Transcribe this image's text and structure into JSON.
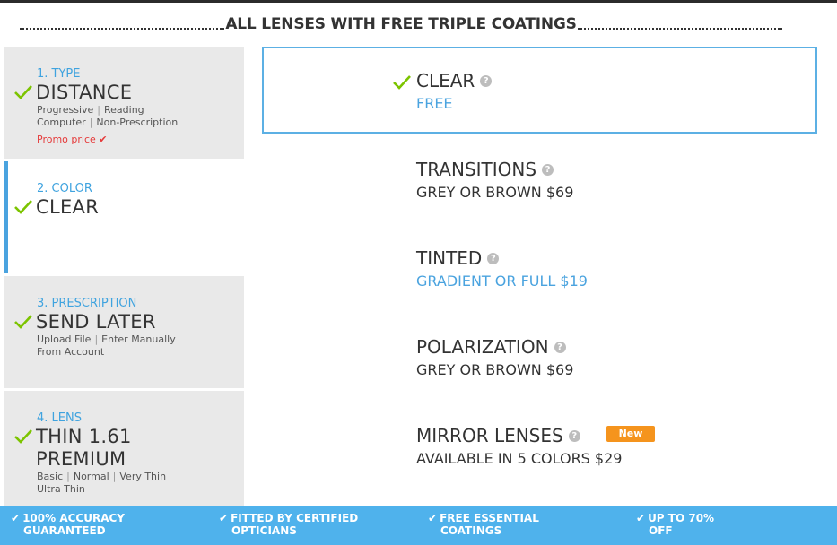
{
  "header": {
    "title": "ALL LENSES WITH FREE TRIPLE COATINGS"
  },
  "steps": [
    {
      "num": "1. TYPE",
      "value": "DISTANCE",
      "options": [
        "Progressive",
        "Reading",
        "Computer",
        "Non-Prescription"
      ],
      "promo": "Promo price ✔"
    },
    {
      "num": "2. COLOR",
      "value": "CLEAR"
    },
    {
      "num": "3. PRESCRIPTION",
      "value": "SEND LATER",
      "options": [
        "Upload File",
        "Enter Manually",
        "From Account"
      ]
    },
    {
      "num": "4. LENS",
      "value_line1": "THIN 1.61",
      "value_line2": "PREMIUM",
      "options": [
        "Basic",
        "Normal",
        "Very Thin",
        "Ultra Thin"
      ]
    }
  ],
  "color_options": [
    {
      "name": "CLEAR",
      "price": "FREE"
    },
    {
      "name": "TRANSITIONS",
      "price": "GREY OR BROWN $69"
    },
    {
      "name": "TINTED",
      "price": "GRADIENT OR FULL $19"
    },
    {
      "name": "POLARIZATION",
      "price": "GREY OR BROWN $69"
    },
    {
      "name": "MIRROR LENSES",
      "price": "AVAILABLE IN 5 COLORS $29",
      "badge": "New"
    }
  ],
  "footer": [
    {
      "line1": "100% ACCURACY",
      "line2": "GUARANTEED"
    },
    {
      "line1": "FITTED BY CERTIFIED",
      "line2": "OPTICIANS"
    },
    {
      "line1": "FREE ESSENTIAL",
      "line2": "COATINGS"
    },
    {
      "line1": "UP TO 70%",
      "line2": "OFF"
    }
  ],
  "colors": {
    "accent_blue": "#4aa3df",
    "check_green": "#7cc400",
    "badge_orange": "#f5941d",
    "promo_red": "#e53a3a",
    "footer_blue": "#4fb2ec"
  },
  "icons": {
    "check": "check-icon",
    "help": "help-icon"
  }
}
